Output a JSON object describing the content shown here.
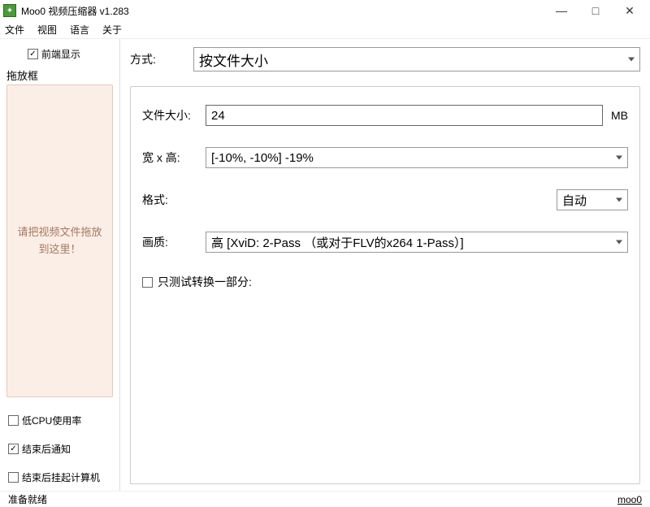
{
  "title": "Moo0 视频压缩器 v1.283",
  "menu": {
    "file": "文件",
    "view": "视图",
    "lang": "语言",
    "about": "关于"
  },
  "sidebar": {
    "topCheck": "前端显示",
    "dropframeLabel": "拖放框",
    "dropHint": "请把视频文件拖放到这里！",
    "lowCpu": "低CPU使用率",
    "notifyDone": "结束后通知",
    "suspendAfter": "结束后挂起计算机"
  },
  "main": {
    "methodLabel": "方式:",
    "methodValue": "按文件大小",
    "filesizeLabel": "文件大小:",
    "filesizeValue": "24",
    "filesizeUnit": "MB",
    "wxhLabel": "宽 x 高:",
    "wxhValue": "[-10%, -10%]    -19%",
    "formatLabel": "格式:",
    "formatValue": "自动",
    "qualityLabel": "画质:",
    "qualityValue": "高      [XviD: 2-Pass   （或对于FLV的x264 1-Pass）]",
    "testOnly": "只测试转换一部分:"
  },
  "status": {
    "ready": "准备就绪",
    "brand": "moo0"
  }
}
